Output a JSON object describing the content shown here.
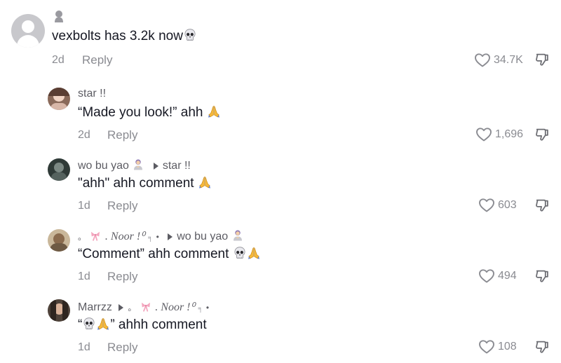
{
  "main_comment": {
    "text": "vexbolts has 3.2k now",
    "age": "2d",
    "reply_label": "Reply",
    "likes": "34.7K"
  },
  "replies": [
    {
      "user": "star !!",
      "text": "“Made you look!” ahh",
      "age": "2d",
      "reply_label": "Reply",
      "likes": "1,696"
    },
    {
      "user": "wo bu yao",
      "reply_to": "star !!",
      "text": "\"ahh\" ahh comment",
      "age": "1d",
      "reply_label": "Reply",
      "likes": "603"
    },
    {
      "user_prefix": "。",
      "user": ". Noor !⁰",
      "user_suffix": "•",
      "reply_to": "wo bu yao",
      "text": "“Comment” ahh comment",
      "age": "1d",
      "reply_label": "Reply",
      "likes": "494"
    },
    {
      "user": "Marrzz",
      "reply_to_prefix": "。",
      "reply_to": ". Noor !⁰",
      "reply_to_suffix": "•",
      "text_pre": "“",
      "text": "” ahhh comment",
      "age": "1d",
      "reply_label": "Reply",
      "likes": "108"
    }
  ],
  "icons": {
    "like": "heart-outline-icon",
    "dislike": "thumbs-down-outline-icon",
    "emoji_skull": "skull-emoji",
    "emoji_pray": "folded-hands-emoji"
  }
}
